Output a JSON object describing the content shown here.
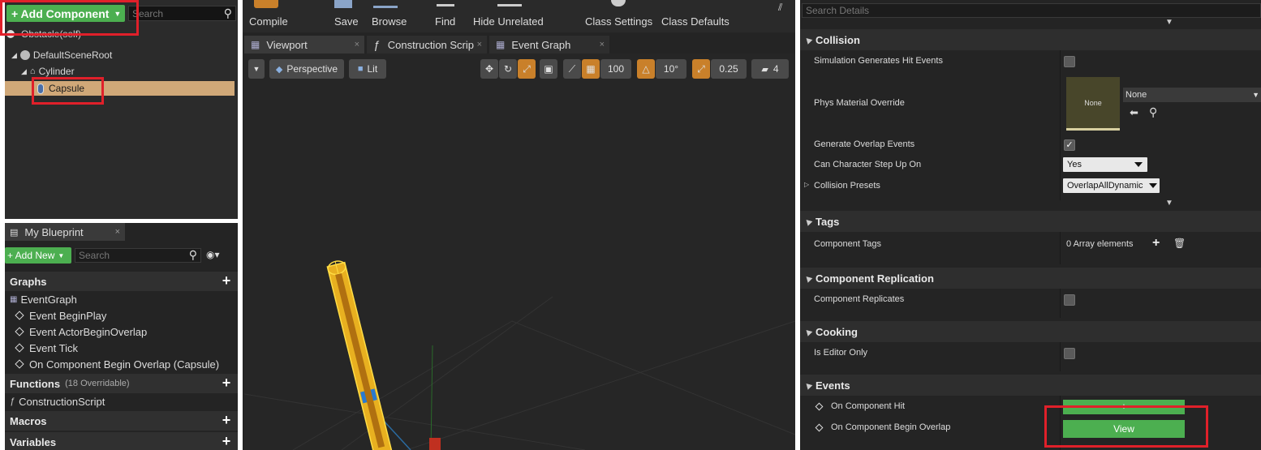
{
  "components": {
    "add_component_label": "+ Add Component",
    "search_placeholder": "Search",
    "self_label": "Obstacle(self)",
    "tree": [
      {
        "label": "DefaultSceneRoot"
      },
      {
        "label": "Cylinder"
      },
      {
        "label": "Capsule"
      }
    ]
  },
  "toolbar": {
    "compile": "Compile",
    "save": "Save",
    "browse": "Browse",
    "find": "Find",
    "hide_unrelated": "Hide Unrelated",
    "class_settings": "Class Settings",
    "class_defaults": "Class Defaults"
  },
  "tabs": [
    {
      "label": "Viewport"
    },
    {
      "label": "Construction Scrip"
    },
    {
      "label": "Event Graph"
    }
  ],
  "viewport": {
    "perspective": "Perspective",
    "lit": "Lit",
    "grid_snap": "100",
    "rot_snap": "10°",
    "scale_snap": "0.25",
    "cam_speed": "4"
  },
  "my_blueprint": {
    "tab_label": "My Blueprint",
    "add_new": "+ Add New",
    "search_placeholder": "Search",
    "graphs_header": "Graphs",
    "graph_items": [
      "EventGraph",
      "Event BeginPlay",
      "Event ActorBeginOverlap",
      "Event Tick",
      "On Component Begin Overlap (Capsule)"
    ],
    "functions_header": "Functions",
    "functions_overridable": "(18 Overridable)",
    "function_items": [
      "ConstructionScript"
    ],
    "macros_header": "Macros",
    "variables_header": "Variables"
  },
  "details": {
    "search_placeholder": "Search Details",
    "collision": {
      "header": "Collision",
      "sim_hit": "Simulation Generates Hit Events",
      "phys_material": "Phys Material Override",
      "phys_thumb": "None",
      "phys_value": "None",
      "gen_overlap": "Generate Overlap Events",
      "step_up": "Can Character Step Up On",
      "step_up_value": "Yes",
      "presets": "Collision Presets",
      "presets_value": "OverlapAllDynamic"
    },
    "tags": {
      "header": "Tags",
      "component_tags": "Component Tags",
      "value": "0 Array elements"
    },
    "replication": {
      "header": "Component Replication",
      "replicates": "Component Replicates"
    },
    "cooking": {
      "header": "Cooking",
      "editor_only": "Is Editor Only"
    },
    "events": {
      "header": "Events",
      "on_hit": "On Component Hit",
      "on_hit_btn": "+",
      "on_overlap": "On Component Begin Overlap",
      "on_overlap_btn": "View"
    }
  }
}
